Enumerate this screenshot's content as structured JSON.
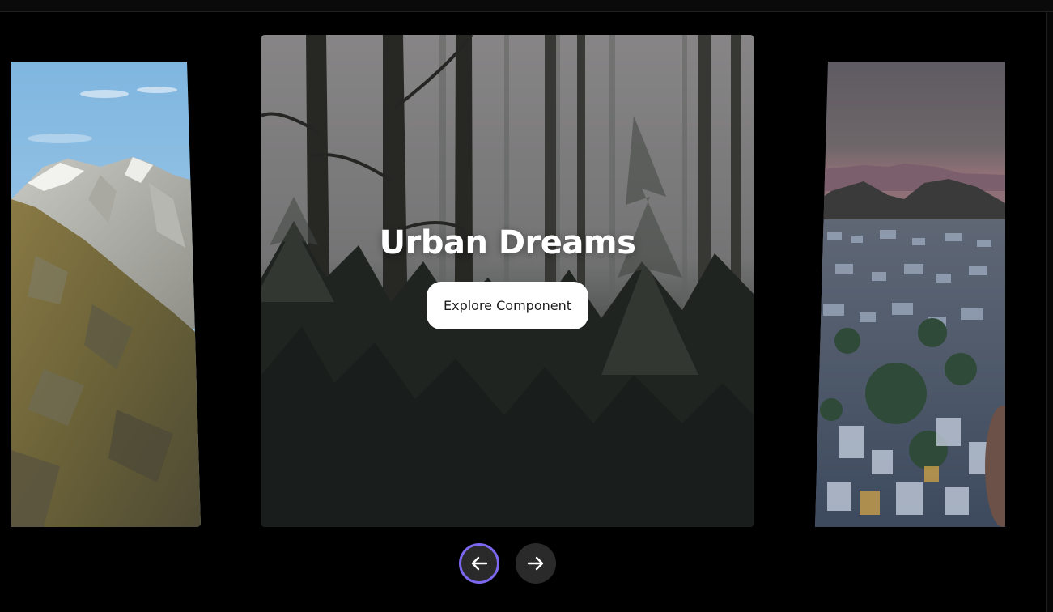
{
  "carousel": {
    "slides": [
      {
        "name": "mountain-slide",
        "position": "left"
      },
      {
        "name": "forest-slide",
        "position": "center",
        "title": "Urban Dreams",
        "button_label": "Explore Component"
      },
      {
        "name": "city-slide",
        "position": "right"
      }
    ],
    "active_index": 1
  },
  "controls": {
    "prev_icon": "arrow-left-icon",
    "next_icon": "arrow-right-icon"
  },
  "colors": {
    "background": "#000000",
    "focus_ring": "#7b68ee",
    "nav_button": "#2a2a2a",
    "button_bg": "#ffffff"
  }
}
